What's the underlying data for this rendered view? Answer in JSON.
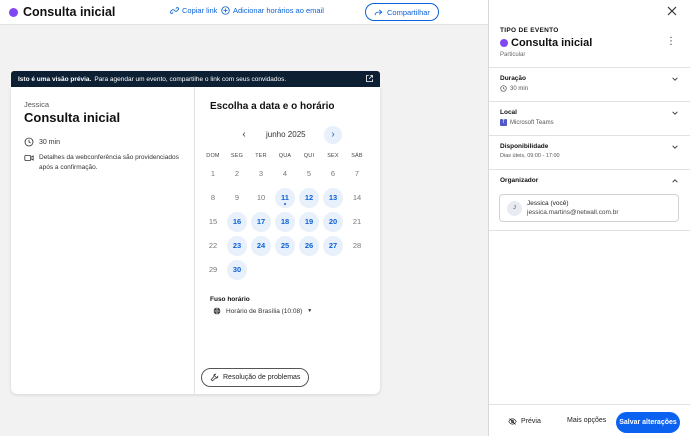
{
  "header": {
    "title": "Consulta inicial",
    "dot_color": "#8247f5",
    "copy_link": "Copiar link",
    "add_times": "Adicionar horários ao email",
    "share": "Compartilhar"
  },
  "banner": {
    "bold": "Isto é uma visão prévia.",
    "text": "Para agendar um evento, compartilhe o link com seus convidados."
  },
  "card": {
    "host": "Jessica",
    "title": "Consulta inicial",
    "duration": "30 min",
    "conference": [
      "Detalhes da webconferência são providenciados",
      "após a confirmação."
    ],
    "calendar_title": "Escolha a data e o horário",
    "month": "junho 2025",
    "weekdays": [
      "DOM",
      "SEG",
      "TER",
      "QUA",
      "QUI",
      "SEX",
      "SÁB"
    ],
    "days": [
      1,
      2,
      3,
      4,
      5,
      6,
      7,
      8,
      9,
      10,
      11,
      12,
      13,
      14,
      15,
      16,
      17,
      18,
      19,
      20,
      21,
      22,
      23,
      24,
      25,
      26,
      27,
      28,
      29,
      30
    ],
    "available": [
      11,
      12,
      13,
      16,
      17,
      18,
      19,
      20,
      23,
      24,
      25,
      26,
      27,
      30
    ],
    "today": 11,
    "timezone_label": "Fuso horário",
    "timezone": "Horário de Brasília (10:08)",
    "troubleshoot": "Resolução de problemas"
  },
  "panel": {
    "kicker": "TIPO DE EVENTO",
    "title": "Consulta inicial",
    "dot_color": "#8247f5",
    "subtitle": "Particular",
    "sections": {
      "duration": {
        "label": "Duração",
        "value": "30 min"
      },
      "location": {
        "label": "Local",
        "value": "Microsoft Teams"
      },
      "availability": {
        "label": "Disponibilidade",
        "value": "Dias úteis, 09:00 - 17:00"
      },
      "organizer": {
        "label": "Organizador"
      }
    },
    "organizer": {
      "initial": "J",
      "name": "Jessica (você)",
      "email": "jessica.martins@netwall.com.br"
    },
    "footer": {
      "preview": "Prévia",
      "more": "Mais opções",
      "save": "Salvar alterações"
    }
  },
  "colors": {
    "accent": "#0b62d6",
    "banner_bg": "#0c1f33"
  }
}
